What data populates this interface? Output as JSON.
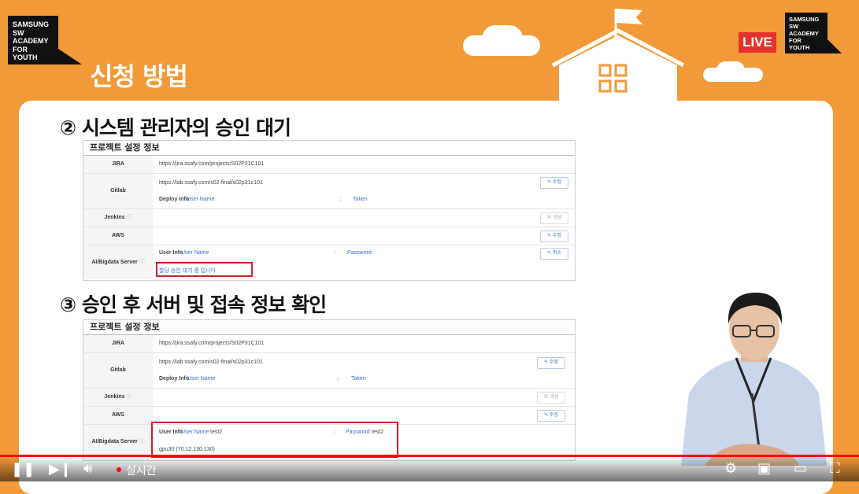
{
  "header": {
    "logo_lines": [
      "SAMSUNG",
      "SW",
      "ACADEMY",
      "FOR",
      "YOUTH"
    ],
    "page_title": "신청 방법",
    "live_label": "LIVE"
  },
  "section1": {
    "heading": "② 시스템 관리자의 승인 대기",
    "table_title": "프로젝트 설정 정보",
    "jira_label": "JIRA",
    "jira_url": "https://jira.ssafy.com/projects/S02P31C101",
    "gitlab_label": "Gitlab",
    "gitlab_url": "https://lab.ssafy.com/s02-final/s02p31c101",
    "deploy_info_label": "Deploy Info",
    "deploy_user": "User Name",
    "deploy_colon": ":",
    "deploy_token": "Token",
    "edit_button": "수정",
    "jenkins_label": "Jenkins",
    "create_button": "생성",
    "aws_label": "AWS",
    "ai_label": "AI/Bigdata Server",
    "user_info_label": "User Info",
    "user_name": "User Name",
    "password": "Password",
    "cancel_button": "취소",
    "pending_text": "할당 승인 대기 중 입니다"
  },
  "section2": {
    "heading": "③ 승인 후 서버 및 접속 정보 확인",
    "table_title": "프로젝트 설정 정보",
    "jira_label": "JIRA",
    "jira_url": "https://jira.ssafy.com/projects/S02P31C101",
    "gitlab_label": "Gitlab",
    "gitlab_url": "https://lab.ssafy.com/s02-final/s02p31c101",
    "deploy_info_label": "Deploy Info",
    "deploy_user": "User Name",
    "deploy_colon": ":",
    "deploy_token": "Token",
    "edit_button": "수정",
    "jenkins_label": "Jenkins",
    "create_button": "생성",
    "aws_label": "AWS",
    "ai_label": "AI/Bigdata Server",
    "user_info_label": "User Info",
    "user_name": "User Name",
    "user_value": "test2",
    "password": "Password",
    "password_value": "test2",
    "server_text": "gpu30 (70.12.130.130)"
  },
  "player": {
    "live_text": "실시간",
    "progress": 1.0,
    "icons": [
      "play-pause-icon",
      "next-icon",
      "volume-icon",
      "settings-icon",
      "miniplayer-icon",
      "theater-icon",
      "fullscreen-icon"
    ]
  },
  "colors": {
    "accent": "#f29a38",
    "live": "#e5322d",
    "redbox": "#d61f26",
    "link": "#3a6bd8"
  }
}
